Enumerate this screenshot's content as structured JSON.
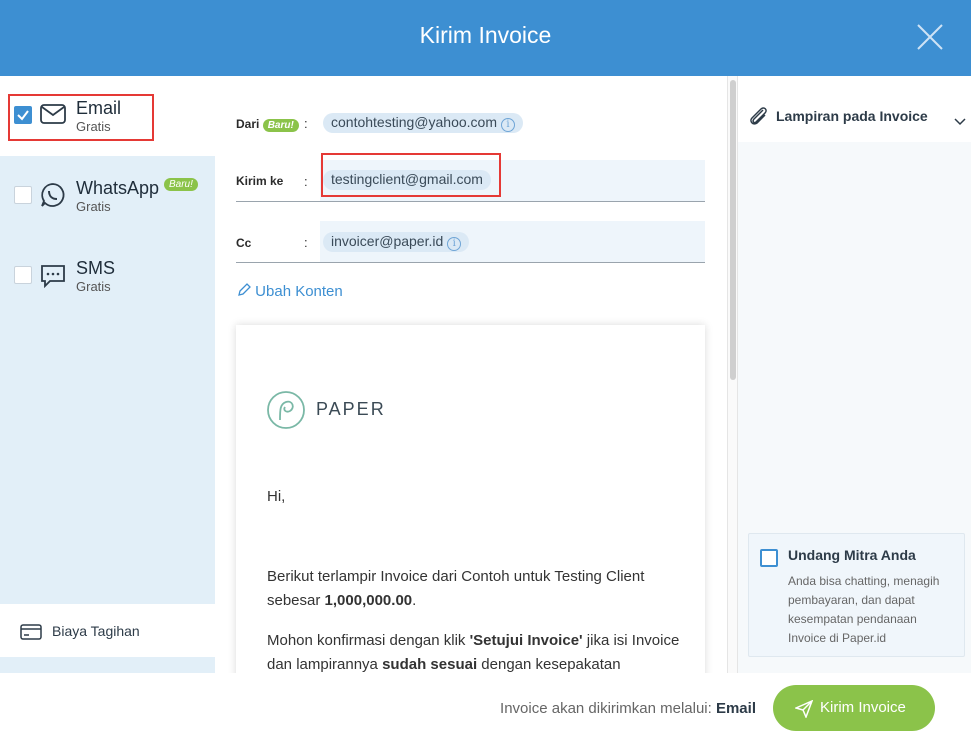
{
  "modal": {
    "title": "Kirim Invoice"
  },
  "channels": [
    {
      "name": "Email",
      "sub": "Gratis",
      "checked": true
    },
    {
      "name": "WhatsApp",
      "sub": "Gratis",
      "badge": "Baru!",
      "checked": false
    },
    {
      "name": "SMS",
      "sub": "Gratis",
      "checked": false
    }
  ],
  "billing": {
    "label": "Biaya Tagihan"
  },
  "form": {
    "from": {
      "label": "Dari",
      "badge": "Baru!",
      "colon": ":",
      "value": "contohtesting@yahoo.com"
    },
    "to": {
      "label": "Kirim ke",
      "colon": ":",
      "value": "testingclient@gmail.com"
    },
    "cc": {
      "label": "Cc",
      "colon": ":",
      "value": "invoicer@paper.id"
    },
    "edit_label": "Ubah Konten"
  },
  "preview": {
    "logo": "PAPER",
    "greeting": "Hi,",
    "line1": "Berikut terlampir Invoice dari Contoh untuk Testing Client sebesar ",
    "amount": "1,000,000.00",
    "line2_a": "Mohon konfirmasi dengan klik ",
    "line2_b": "'Setujui Invoice'",
    "line2_c": " jika isi Invoice dan lampirannya ",
    "line2_d": "sudah sesuai",
    "line2_e": " dengan kesepakatan"
  },
  "attachment": {
    "title": "Lampiran pada Invoice"
  },
  "invite": {
    "title": "Undang Mitra Anda",
    "text": "Anda bisa chatting, menagih pembayaran, dan dapat kesempatan pendanaan Invoice di Paper.id"
  },
  "footer": {
    "sent_via": "Invoice akan dikirimkan melalui:",
    "sent_via_value": "Email",
    "send_label": "Kirim Invoice"
  },
  "colors": {
    "primary": "#3d8fd2",
    "accent_green": "#8bc34a",
    "sidebar_bg": "#e2eff8",
    "highlight": "#e53935"
  }
}
